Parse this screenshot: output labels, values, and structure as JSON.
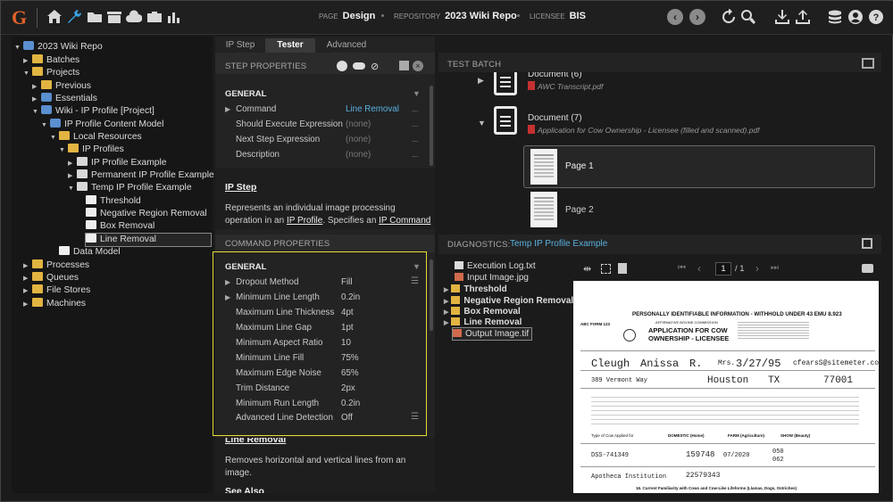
{
  "topbar": {
    "logo": "G",
    "page_label": "PAGE",
    "page_value": "Design",
    "repo_label": "REPOSITORY",
    "repo_value": "2023 Wiki Repo",
    "licensee_label": "LICENSEE",
    "licensee_value": "BIS"
  },
  "tree": [
    {
      "label": "2023 Wiki Repo",
      "arrow": "▼",
      "icon": "gear"
    },
    {
      "label": "Batches",
      "arrow": "▶",
      "icon": "folder"
    },
    {
      "label": "Projects",
      "arrow": "▼",
      "icon": "folder"
    },
    {
      "label": "Previous",
      "arrow": "▶",
      "icon": "folder"
    },
    {
      "label": "Essentials",
      "arrow": "▶",
      "icon": "gear"
    },
    {
      "label": "Wiki - IP Profile [Project]",
      "arrow": "▼",
      "icon": "gear"
    },
    {
      "label": "IP Profile Content Model",
      "arrow": "▼",
      "icon": "gear"
    },
    {
      "label": "Local Resources",
      "arrow": "▼",
      "icon": "folder"
    },
    {
      "label": "IP Profiles",
      "arrow": "▼",
      "icon": "folder"
    },
    {
      "label": "IP Profile Example",
      "arrow": "▶",
      "icon": "doc"
    },
    {
      "label": "Permanent IP Profile Example",
      "arrow": "▶",
      "icon": "doc"
    },
    {
      "label": "Temp IP Profile Example",
      "arrow": "▼",
      "icon": "doc"
    },
    {
      "label": "Threshold",
      "arrow": "",
      "icon": "page"
    },
    {
      "label": "Negative Region Removal",
      "arrow": "",
      "icon": "page"
    },
    {
      "label": "Box Removal",
      "arrow": "",
      "icon": "page"
    },
    {
      "label": "Line Removal",
      "arrow": "",
      "icon": "page"
    },
    {
      "label": "Data Model",
      "arrow": "",
      "icon": "page"
    },
    {
      "label": "Processes",
      "arrow": "▶",
      "icon": "folder"
    },
    {
      "label": "Queues",
      "arrow": "▶",
      "icon": "folder"
    },
    {
      "label": "File Stores",
      "arrow": "▶",
      "icon": "folder"
    },
    {
      "label": "Machines",
      "arrow": "▶",
      "icon": "folder"
    }
  ],
  "mid": {
    "tabs": [
      "IP Step",
      "Tester",
      "Advanced"
    ],
    "step_properties": "STEP PROPERTIES",
    "general": "GENERAL",
    "step_props": [
      {
        "label": "Command",
        "value": "Line Removal"
      },
      {
        "label": "Should Execute Expression",
        "value": "(none)"
      },
      {
        "label": "Next Step Expression",
        "value": "(none)"
      },
      {
        "label": "Description",
        "value": "(none)"
      }
    ],
    "ipstep_title": "IP Step",
    "ipstep_desc_1": "Represents an individual image processing",
    "ipstep_desc_2a": "operation in an ",
    "ipstep_desc_2b": "IP Profile",
    "ipstep_desc_2c": ". Specifies an ",
    "ipstep_desc_2d": "IP Command",
    "command_properties": "COMMAND PROPERTIES",
    "cmd_props": [
      {
        "label": "Dropout Method",
        "value": "Fill"
      },
      {
        "label": "Minimum Line Length",
        "value": "0.2in"
      },
      {
        "label": "Maximum Line Thickness",
        "value": "4pt"
      },
      {
        "label": "Maximum Line Gap",
        "value": "1pt"
      },
      {
        "label": "Minimum Aspect Ratio",
        "value": "10"
      },
      {
        "label": "Minimum Line Fill",
        "value": "75%"
      },
      {
        "label": "Maximum Edge Noise",
        "value": "65%"
      },
      {
        "label": "Trim Distance",
        "value": "2px"
      },
      {
        "label": "Minimum Run Length",
        "value": "0.2in"
      },
      {
        "label": "Advanced Line Detection",
        "value": "Off"
      }
    ],
    "lr_title": "Line Removal",
    "lr_desc_1": "Removes horizontal and vertical lines from an",
    "lr_desc_2": "image.",
    "see_also": "See Also"
  },
  "batch": {
    "title": "TEST BATCH",
    "doc6": "Document (6)",
    "doc6_file": "AWC Transcript.pdf",
    "doc7": "Document (7)",
    "doc7_file": "Application for Cow Ownership - Licensee (filled and scanned).pdf",
    "page1": "Page 1",
    "page2": "Page 2"
  },
  "diag": {
    "title": "DIAGNOSTICS:",
    "profile": "Temp IP Profile Example",
    "files": [
      {
        "label": "Execution Log.txt",
        "bold": false
      },
      {
        "label": "Input Image.jpg",
        "bold": false
      },
      {
        "label": "Threshold",
        "bold": true
      },
      {
        "label": "Negative Region Removal",
        "bold": true
      },
      {
        "label": "Box Removal",
        "bold": true
      },
      {
        "label": "Line Removal",
        "bold": true
      },
      {
        "label": "Output Image.tif",
        "bold": false
      }
    ],
    "page_num": "1",
    "page_total": "/ 1"
  },
  "form": {
    "title": "PERSONALLY IDENTIFIABLE INFORMATION - WITHHOLD UNDER 43 EMU 8.923",
    "form_id": "ABC FORM 123",
    "app_title_1": "APPLICATION FOR COW",
    "app_title_2": "OWNERSHIP - LICENSEE",
    "commission": "AFFIRMATIVE BOVINE COMMISSION",
    "last_name": "Cleugh",
    "first_name": "Anissa",
    "initial": "R.",
    "title_val": "Mrs.",
    "dob": "3/27/95",
    "email": "cfearsS@sitemeter.com",
    "address": "389 Vermont Way",
    "city": "Houston",
    "state": "TX",
    "zip": "77001",
    "cert_type": "Type of Cow Applied for",
    "domestic": "DOMESTIC (Home)",
    "farm": "FARM (Agriculture)",
    "show": "SHOW (Beauty)",
    "num1": "DSS-741349",
    "num2": "159748",
    "date2": "07/2020",
    "num3": "050",
    "num4": "062",
    "facility": "Apotheca Institution",
    "num5": "22579343",
    "footer": "16. Current Familiarity with Cows and Cow-Like Lifeforms (Llamas, Dogs, Ostriches)"
  }
}
